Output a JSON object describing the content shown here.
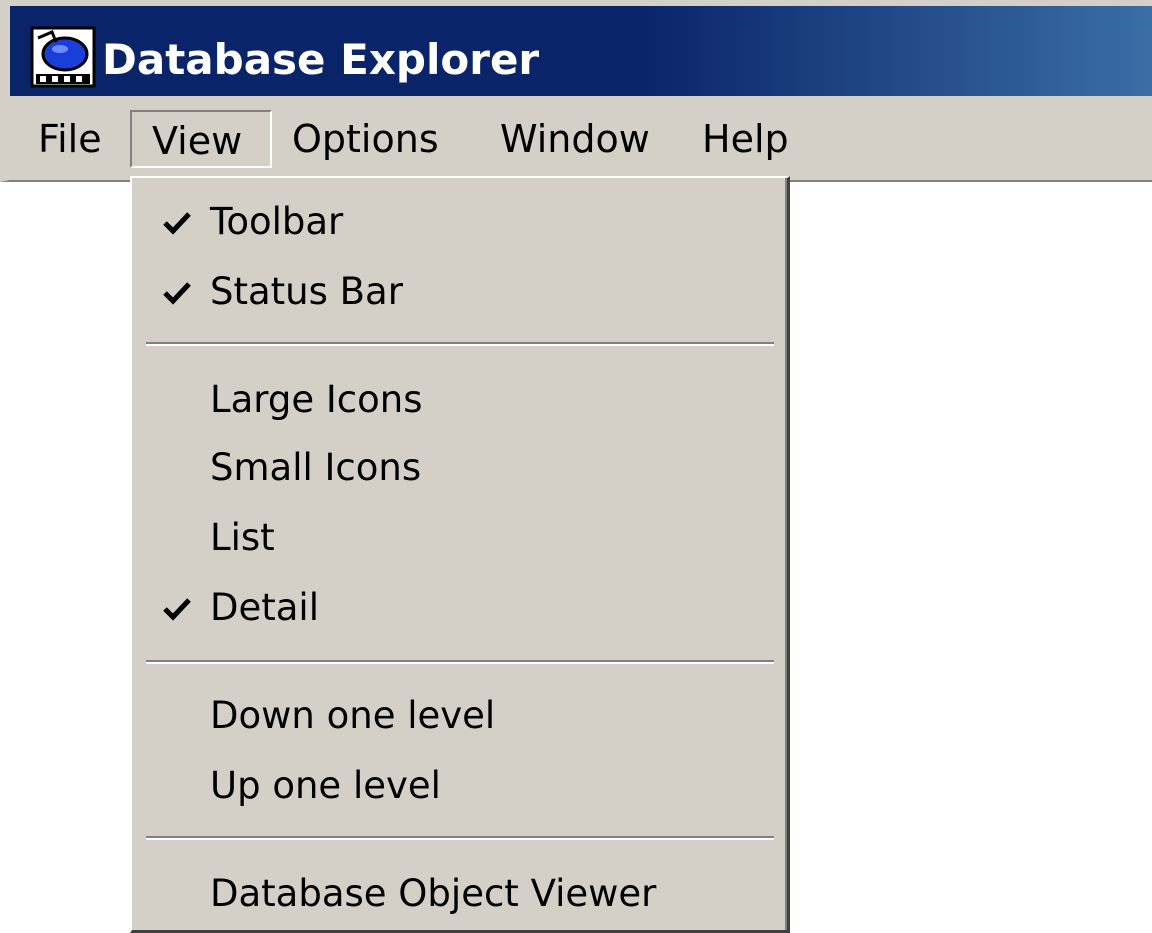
{
  "window": {
    "title": "Database Explorer",
    "app_icon": "database-explorer-icon",
    "colors": {
      "titlebar_active": "#0a246a",
      "titlebar_gradient_end": "#3a6ea5",
      "face": "#d4d0c8",
      "title_text": "#ffffff"
    }
  },
  "menubar": {
    "items": [
      {
        "label": "File"
      },
      {
        "label": "View",
        "open": true
      },
      {
        "label": "Options"
      },
      {
        "label": "Window"
      },
      {
        "label": "Help"
      }
    ]
  },
  "view_menu": {
    "items": [
      {
        "label": "Toolbar",
        "checked": true
      },
      {
        "label": "Status Bar",
        "checked": true
      },
      {
        "label": "Large Icons",
        "checked": false
      },
      {
        "label": "Small Icons",
        "checked": false
      },
      {
        "label": "List",
        "checked": false
      },
      {
        "label": "Detail",
        "checked": true
      },
      {
        "label": "Down one level",
        "checked": false
      },
      {
        "label": "Up one level",
        "checked": false
      },
      {
        "label": "Database Object Viewer",
        "checked": false
      }
    ],
    "check_icon": "checkmark-icon"
  }
}
